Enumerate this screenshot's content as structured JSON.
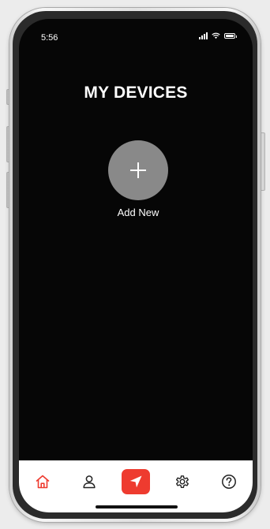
{
  "status_bar": {
    "time": "5:56",
    "icons": [
      "signal-icon",
      "wifi-icon",
      "battery-icon"
    ]
  },
  "main": {
    "title": "MY DEVICES",
    "add_button_icon": "plus-icon",
    "add_label": "Add New"
  },
  "tab_bar": {
    "items": [
      {
        "icon": "home-icon",
        "active": true
      },
      {
        "icon": "person-icon",
        "active": false
      },
      {
        "icon": "navigation-arrow-icon",
        "active": false
      },
      {
        "icon": "gear-icon",
        "active": false
      },
      {
        "icon": "help-icon",
        "active": false
      }
    ]
  },
  "colors": {
    "screen_bg": "#060606",
    "accent": "#ee3b2f",
    "add_button_bg": "#898989",
    "tab_bar_bg": "#ffffff"
  }
}
